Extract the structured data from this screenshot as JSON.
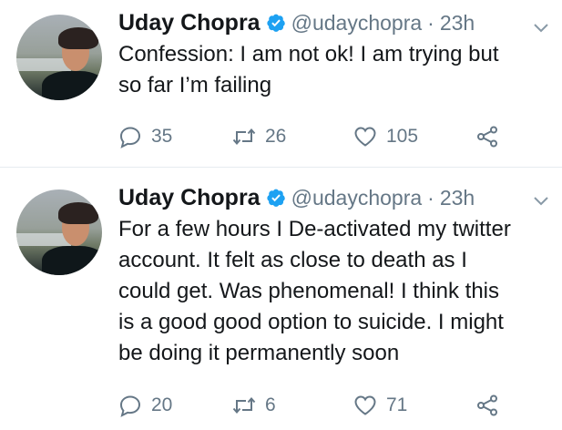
{
  "tweets": [
    {
      "author_name": "Uday Chopra",
      "handle": "@udaychopra",
      "separator": "·",
      "time": "23h",
      "text_lines": [
        "Confession: I am not ok! I am trying but",
        "so far I’m failing"
      ],
      "replies": "35",
      "retweets": "26",
      "likes": "105"
    },
    {
      "author_name": "Uday Chopra",
      "handle": "@udaychopra",
      "separator": "·",
      "time": "23h",
      "text_lines": [
        "For a few hours I De-activated my twitter",
        "account. It felt as close to death as I",
        "could get. Was phenomenal! I think this",
        "is a good good option to suicide. I might",
        "be doing it permanently soon"
      ],
      "replies": "20",
      "retweets": "6",
      "likes": "71"
    }
  ],
  "colors": {
    "verified": "#1da1f2",
    "icon_gray": "#657786",
    "text": "#14171a",
    "divider": "#e6ecf0"
  },
  "icons": {
    "verified": "verified-badge-icon",
    "caret": "chevron-down-icon",
    "reply": "reply-icon",
    "retweet": "retweet-icon",
    "like": "heart-icon",
    "share": "share-icon"
  }
}
